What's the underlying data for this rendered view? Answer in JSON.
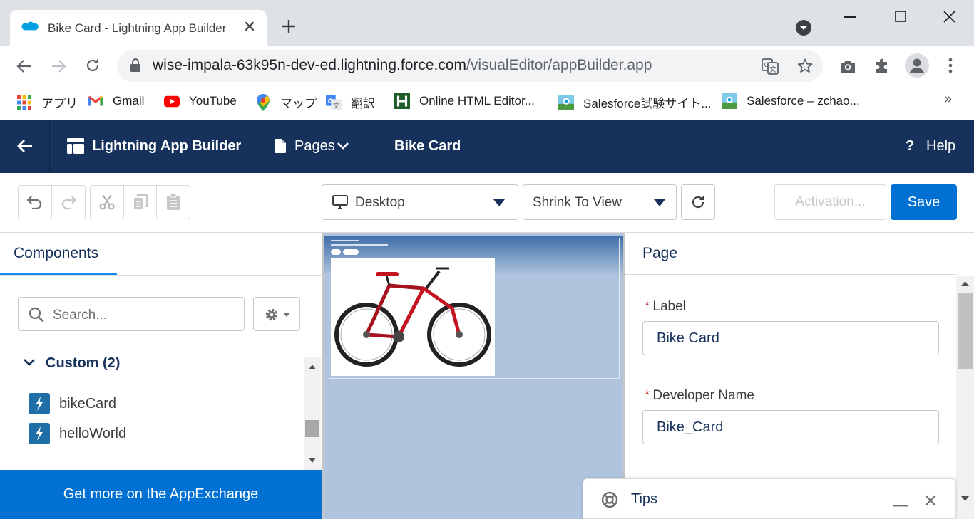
{
  "browser": {
    "tab_title": "Bike Card - Lightning App Builder",
    "url_host": "wise-impala-63k95n-dev-ed.lightning.force.com",
    "url_path": "/visualEditor/appBuilder.app",
    "bookmarks": [
      "アプリ",
      "Gmail",
      "YouTube",
      "マップ",
      "翻訳",
      "Online HTML Editor...",
      "Salesforce試験サイト...",
      "Salesforce – zchao..."
    ],
    "more_bookmarks": "»"
  },
  "header": {
    "app_name": "Lightning App Builder",
    "pages_label": "Pages",
    "page_name": "Bike Card",
    "help_label": "Help"
  },
  "toolbar": {
    "device_select": "Desktop",
    "zoom_select": "Shrink To View",
    "activation_label": "Activation...",
    "save_label": "Save"
  },
  "components_panel": {
    "tab_label": "Components",
    "search_placeholder": "Search...",
    "section_title": "Custom (2)",
    "items": [
      "bikeCard",
      "helloWorld"
    ],
    "appexchange_label": "Get more on the AppExchange"
  },
  "properties_panel": {
    "title": "Page",
    "fields": [
      {
        "label": "Label",
        "value": "Bike Card",
        "required": "*"
      },
      {
        "label": "Developer Name",
        "value": "Bike_Card",
        "required": "*"
      }
    ]
  },
  "tips": {
    "title": "Tips"
  },
  "colors": {
    "header_bg": "#16325c",
    "brand_blue": "#0070d2",
    "canvas_bg": "#b0c4de"
  }
}
